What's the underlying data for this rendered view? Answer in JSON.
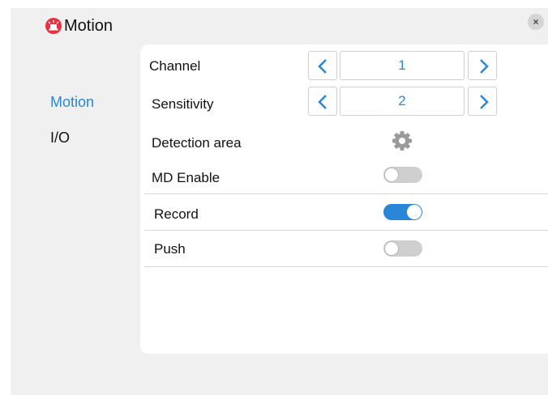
{
  "window": {
    "title": "Motion",
    "close_label": "×"
  },
  "sidebar": {
    "items": [
      {
        "label": "Motion",
        "active": true
      },
      {
        "label": "I/O",
        "active": false
      }
    ]
  },
  "settings": {
    "channel": {
      "label": "Channel",
      "value": "1"
    },
    "sensitivity": {
      "label": "Sensitivity",
      "value": "2"
    },
    "detection_area": {
      "label": "Detection area",
      "icon": "gear-icon"
    },
    "md_enable": {
      "label": "MD Enable",
      "enabled": false
    },
    "record": {
      "label": "Record",
      "enabled": true
    },
    "push": {
      "label": "Push",
      "enabled": false
    }
  },
  "colors": {
    "accent": "#2a86d8",
    "alarm_icon": "#e8323f",
    "toggle_off": "#cfcfcf"
  }
}
